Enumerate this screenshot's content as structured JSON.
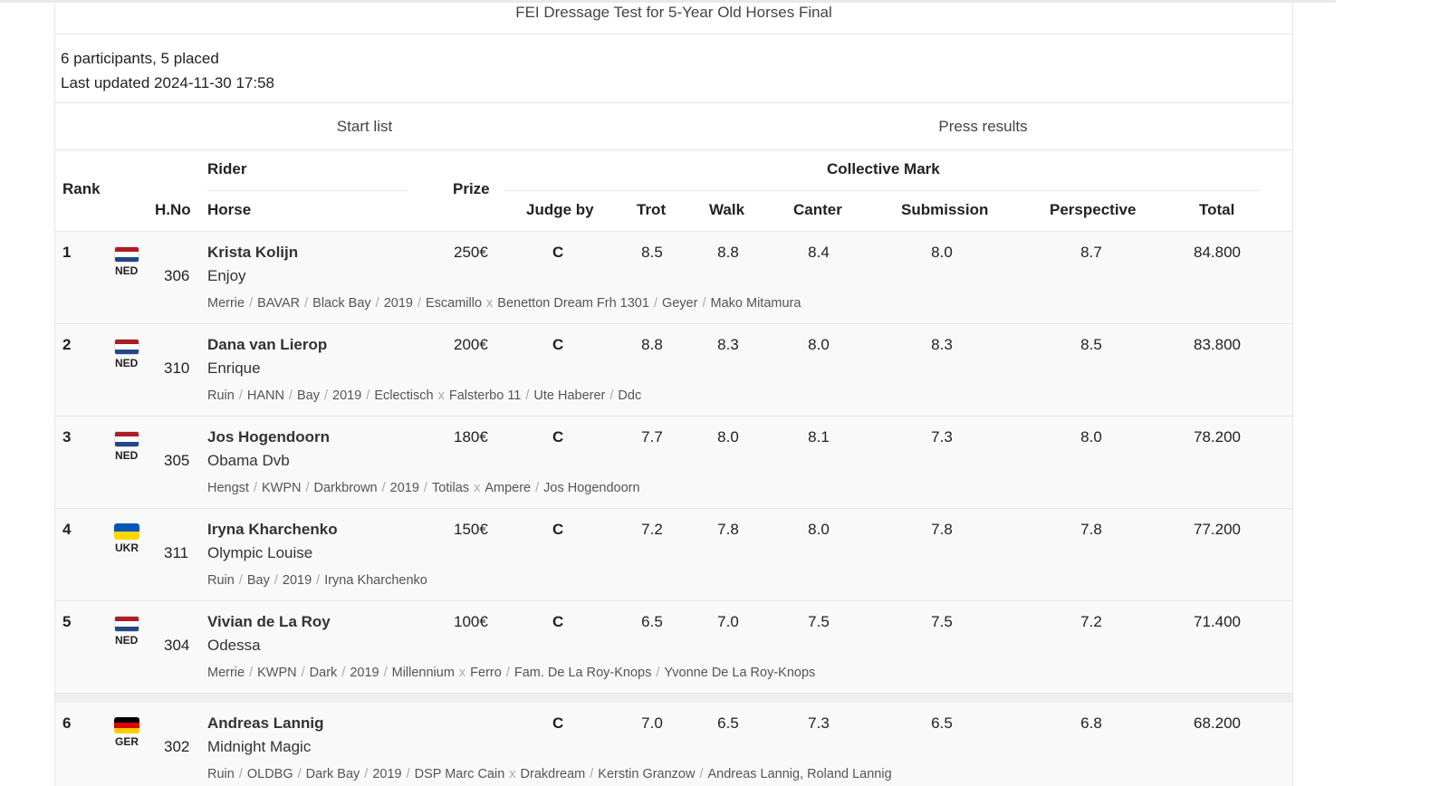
{
  "title": "FEI Dressage Test for 5-Year Old Horses Final",
  "summary": {
    "participants": "6 participants, 5 placed",
    "updated": "Last updated 2024-11-30 17:58"
  },
  "tabs": [
    "Start list",
    "Press results"
  ],
  "headers": {
    "rank": "Rank",
    "hno": "H.No",
    "rider": "Rider",
    "horse": "Horse",
    "prize": "Prize",
    "collective": "Collective Mark",
    "judge": "Judge by",
    "trot": "Trot",
    "walk": "Walk",
    "canter": "Canter",
    "submission": "Submission",
    "perspective": "Perspective",
    "total": "Total"
  },
  "flags": {
    "NED": [
      "#ae1c28",
      "#ffffff",
      "#21468b"
    ],
    "UKR": [
      "#0057b7",
      "#ffd700"
    ],
    "GER": [
      "#000000",
      "#dd0000",
      "#ffce00"
    ]
  },
  "rows": [
    {
      "rank": "1",
      "nation": "NED",
      "hno": "306",
      "rider": "Krista Kolijn",
      "horse": "Enjoy",
      "details": [
        "Merrie",
        "BAVAR",
        "Black Bay",
        "2019",
        "Escamillo",
        "x",
        "Benetton Dream Frh 1301",
        "Geyer",
        "Mako Mitamura"
      ],
      "prize": "250€",
      "judge": "C",
      "trot": "8.5",
      "walk": "8.8",
      "canter": "8.4",
      "submission": "8.0",
      "perspective": "8.7",
      "total": "84.800"
    },
    {
      "rank": "2",
      "nation": "NED",
      "hno": "310",
      "rider": "Dana van Lierop",
      "horse": "Enrique",
      "details": [
        "Ruin",
        "HANN",
        "Bay",
        "2019",
        "Eclectisch",
        "x",
        "Falsterbo 11",
        "Ute Haberer",
        "Ddc"
      ],
      "prize": "200€",
      "judge": "C",
      "trot": "8.8",
      "walk": "8.3",
      "canter": "8.0",
      "submission": "8.3",
      "perspective": "8.5",
      "total": "83.800"
    },
    {
      "rank": "3",
      "nation": "NED",
      "hno": "305",
      "rider": "Jos Hogendoorn",
      "horse": "Obama Dvb",
      "details": [
        "Hengst",
        "KWPN",
        "Darkbrown",
        "2019",
        "Totilas",
        "x",
        "Ampere",
        "Jos Hogendoorn"
      ],
      "prize": "180€",
      "judge": "C",
      "trot": "7.7",
      "walk": "8.0",
      "canter": "8.1",
      "submission": "7.3",
      "perspective": "8.0",
      "total": "78.200"
    },
    {
      "rank": "4",
      "nation": "UKR",
      "hno": "311",
      "rider": "Iryna Kharchenko",
      "horse": "Olympic Louise",
      "details": [
        "Ruin",
        "Bay",
        "2019",
        "Iryna Kharchenko"
      ],
      "prize": "150€",
      "judge": "C",
      "trot": "7.2",
      "walk": "7.8",
      "canter": "8.0",
      "submission": "7.8",
      "perspective": "7.8",
      "total": "77.200"
    },
    {
      "rank": "5",
      "nation": "NED",
      "hno": "304",
      "rider": "Vivian de La Roy",
      "horse": "Odessa",
      "details": [
        "Merrie",
        "KWPN",
        "Dark",
        "2019",
        "Millennium",
        "x",
        "Ferro",
        "Fam. De La Roy-Knops",
        "Yvonne De La Roy-Knops"
      ],
      "prize": "100€",
      "judge": "C",
      "trot": "6.5",
      "walk": "7.0",
      "canter": "7.5",
      "submission": "7.5",
      "perspective": "7.2",
      "total": "71.400"
    },
    {
      "rank": "6",
      "nation": "GER",
      "hno": "302",
      "rider": "Andreas Lannig",
      "horse": "Midnight Magic",
      "details": [
        "Ruin",
        "OLDBG",
        "Dark Bay",
        "2019",
        "DSP Marc Cain",
        "x",
        "Drakdream",
        "Kerstin Granzow",
        "Andreas Lannig, Roland Lannig"
      ],
      "prize": "",
      "judge": "C",
      "trot": "7.0",
      "walk": "6.5",
      "canter": "7.3",
      "submission": "6.5",
      "perspective": "6.8",
      "total": "68.200"
    }
  ]
}
